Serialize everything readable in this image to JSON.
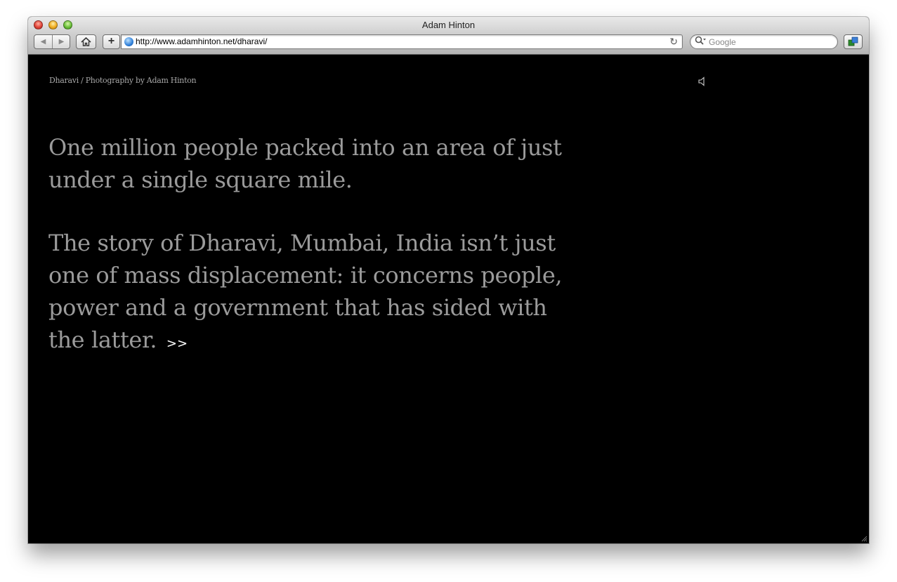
{
  "window": {
    "title": "Adam Hinton"
  },
  "toolbar": {
    "back_icon": "◀",
    "forward_icon": "▶",
    "home_icon": "⌂",
    "add_label": "+",
    "url": "http://www.adamhinton.net/dharavi/",
    "reload_icon": "↻",
    "search_placeholder": "Google"
  },
  "page": {
    "site_title": "Dharavi / Photography by Adam Hinton",
    "intro": "One million people packed into an area of just under a single square mile.",
    "story": "The story of Dharavi, Mumbai, India isn’t just one of mass displacement: it concerns people, power and a government that has sided with the latter.",
    "more_link": ">>"
  },
  "colors": {
    "background": "#000000",
    "text": "#9b9b9b",
    "link": "#ffffff"
  }
}
